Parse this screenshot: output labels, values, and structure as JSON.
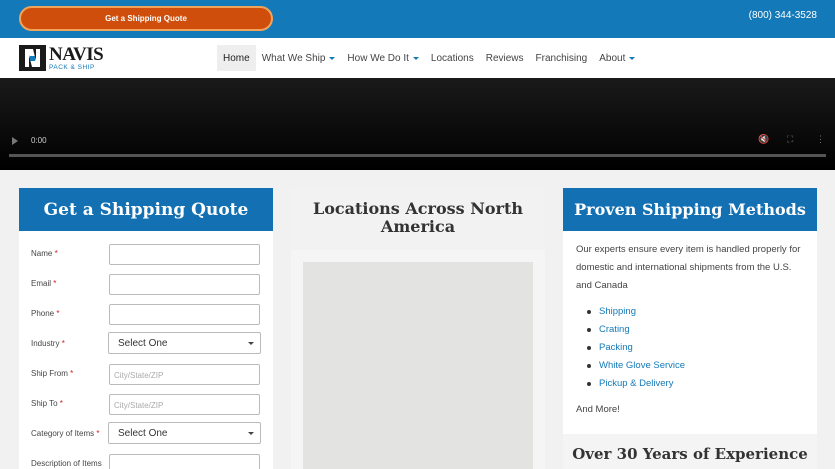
{
  "topbar": {
    "quote_button": "Get a Shipping Quote",
    "phone": "(800) 344-3528"
  },
  "brand": {
    "name": "NAVIS",
    "sub": "PACK & SHIP",
    "color": "#1479b8"
  },
  "nav": {
    "items": [
      {
        "label": "Home",
        "active": true
      },
      {
        "label": "What We Ship",
        "dropdown": true
      },
      {
        "label": "How We Do It",
        "dropdown": true
      },
      {
        "label": "Locations"
      },
      {
        "label": "Reviews"
      },
      {
        "label": "Franchising"
      },
      {
        "label": "About",
        "dropdown": true
      }
    ]
  },
  "video": {
    "time": "0:00"
  },
  "quote_form": {
    "title": "Get a Shipping Quote",
    "fields": {
      "name": {
        "label": "Name",
        "required": "*",
        "value": ""
      },
      "email": {
        "label": "Email",
        "required": "*",
        "value": ""
      },
      "phone": {
        "label": "Phone",
        "required": "*",
        "value": ""
      },
      "industry": {
        "label": "Industry",
        "required": "*",
        "value": "Select One"
      },
      "ship_from": {
        "label": "Ship From",
        "required": "*",
        "placeholder": "City/State/ZIP"
      },
      "ship_to": {
        "label": "Ship To",
        "required": "*",
        "placeholder": "City/State/ZIP"
      },
      "category": {
        "label": "Category of Items",
        "required": "*",
        "value": "Select One"
      },
      "description": {
        "label": "Description of Items",
        "value": ""
      }
    }
  },
  "locations": {
    "title": "Locations Across North America"
  },
  "methods": {
    "title": "Proven Shipping Methods",
    "intro": "Our experts ensure every item is handled properly for domestic and international shipments from the U.S. and Canada",
    "items": [
      "Shipping",
      "Crating",
      "Packing",
      "White Glove Service",
      "Pickup & Delivery"
    ],
    "more": "And More!",
    "years_title": "Over 30 Years of Experience"
  }
}
